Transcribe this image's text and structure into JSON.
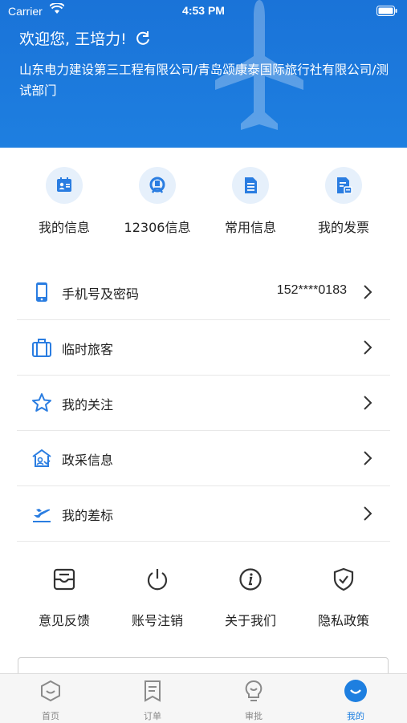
{
  "status_bar": {
    "carrier": "Carrier",
    "time": "4:53 PM"
  },
  "header": {
    "welcome": "欢迎您, 王培力!",
    "company": "山东电力建设第三工程有限公司/青岛颂康泰国际旅行社有限公司/测试部门"
  },
  "quick_links": [
    {
      "label": "我的信息",
      "icon": "id-card-icon"
    },
    {
      "label": "12306信息",
      "icon": "train-icon"
    },
    {
      "label": "常用信息",
      "icon": "document-icon"
    },
    {
      "label": "我的发票",
      "icon": "invoice-icon"
    }
  ],
  "menu": [
    {
      "label": "手机号及密码",
      "value": "152****0183",
      "icon": "phone-icon"
    },
    {
      "label": "临时旅客",
      "value": "",
      "icon": "suitcase-icon"
    },
    {
      "label": "我的关注",
      "value": "",
      "icon": "star-icon"
    },
    {
      "label": "政采信息",
      "value": "",
      "icon": "government-icon"
    },
    {
      "label": "我的差标",
      "value": "",
      "icon": "flight-standard-icon"
    }
  ],
  "actions": [
    {
      "label": "意见反馈",
      "icon": "feedback-icon"
    },
    {
      "label": "账号注销",
      "icon": "power-icon"
    },
    {
      "label": "关于我们",
      "icon": "info-icon"
    },
    {
      "label": "隐私政策",
      "icon": "shield-icon"
    }
  ],
  "tabs": [
    {
      "label": "首页",
      "icon": "home-icon"
    },
    {
      "label": "订单",
      "icon": "order-icon"
    },
    {
      "label": "审批",
      "icon": "approval-icon"
    },
    {
      "label": "我的",
      "icon": "profile-icon"
    }
  ],
  "colors": {
    "primary": "#1e7fe0",
    "icon_bg": "#e6f0fb"
  }
}
